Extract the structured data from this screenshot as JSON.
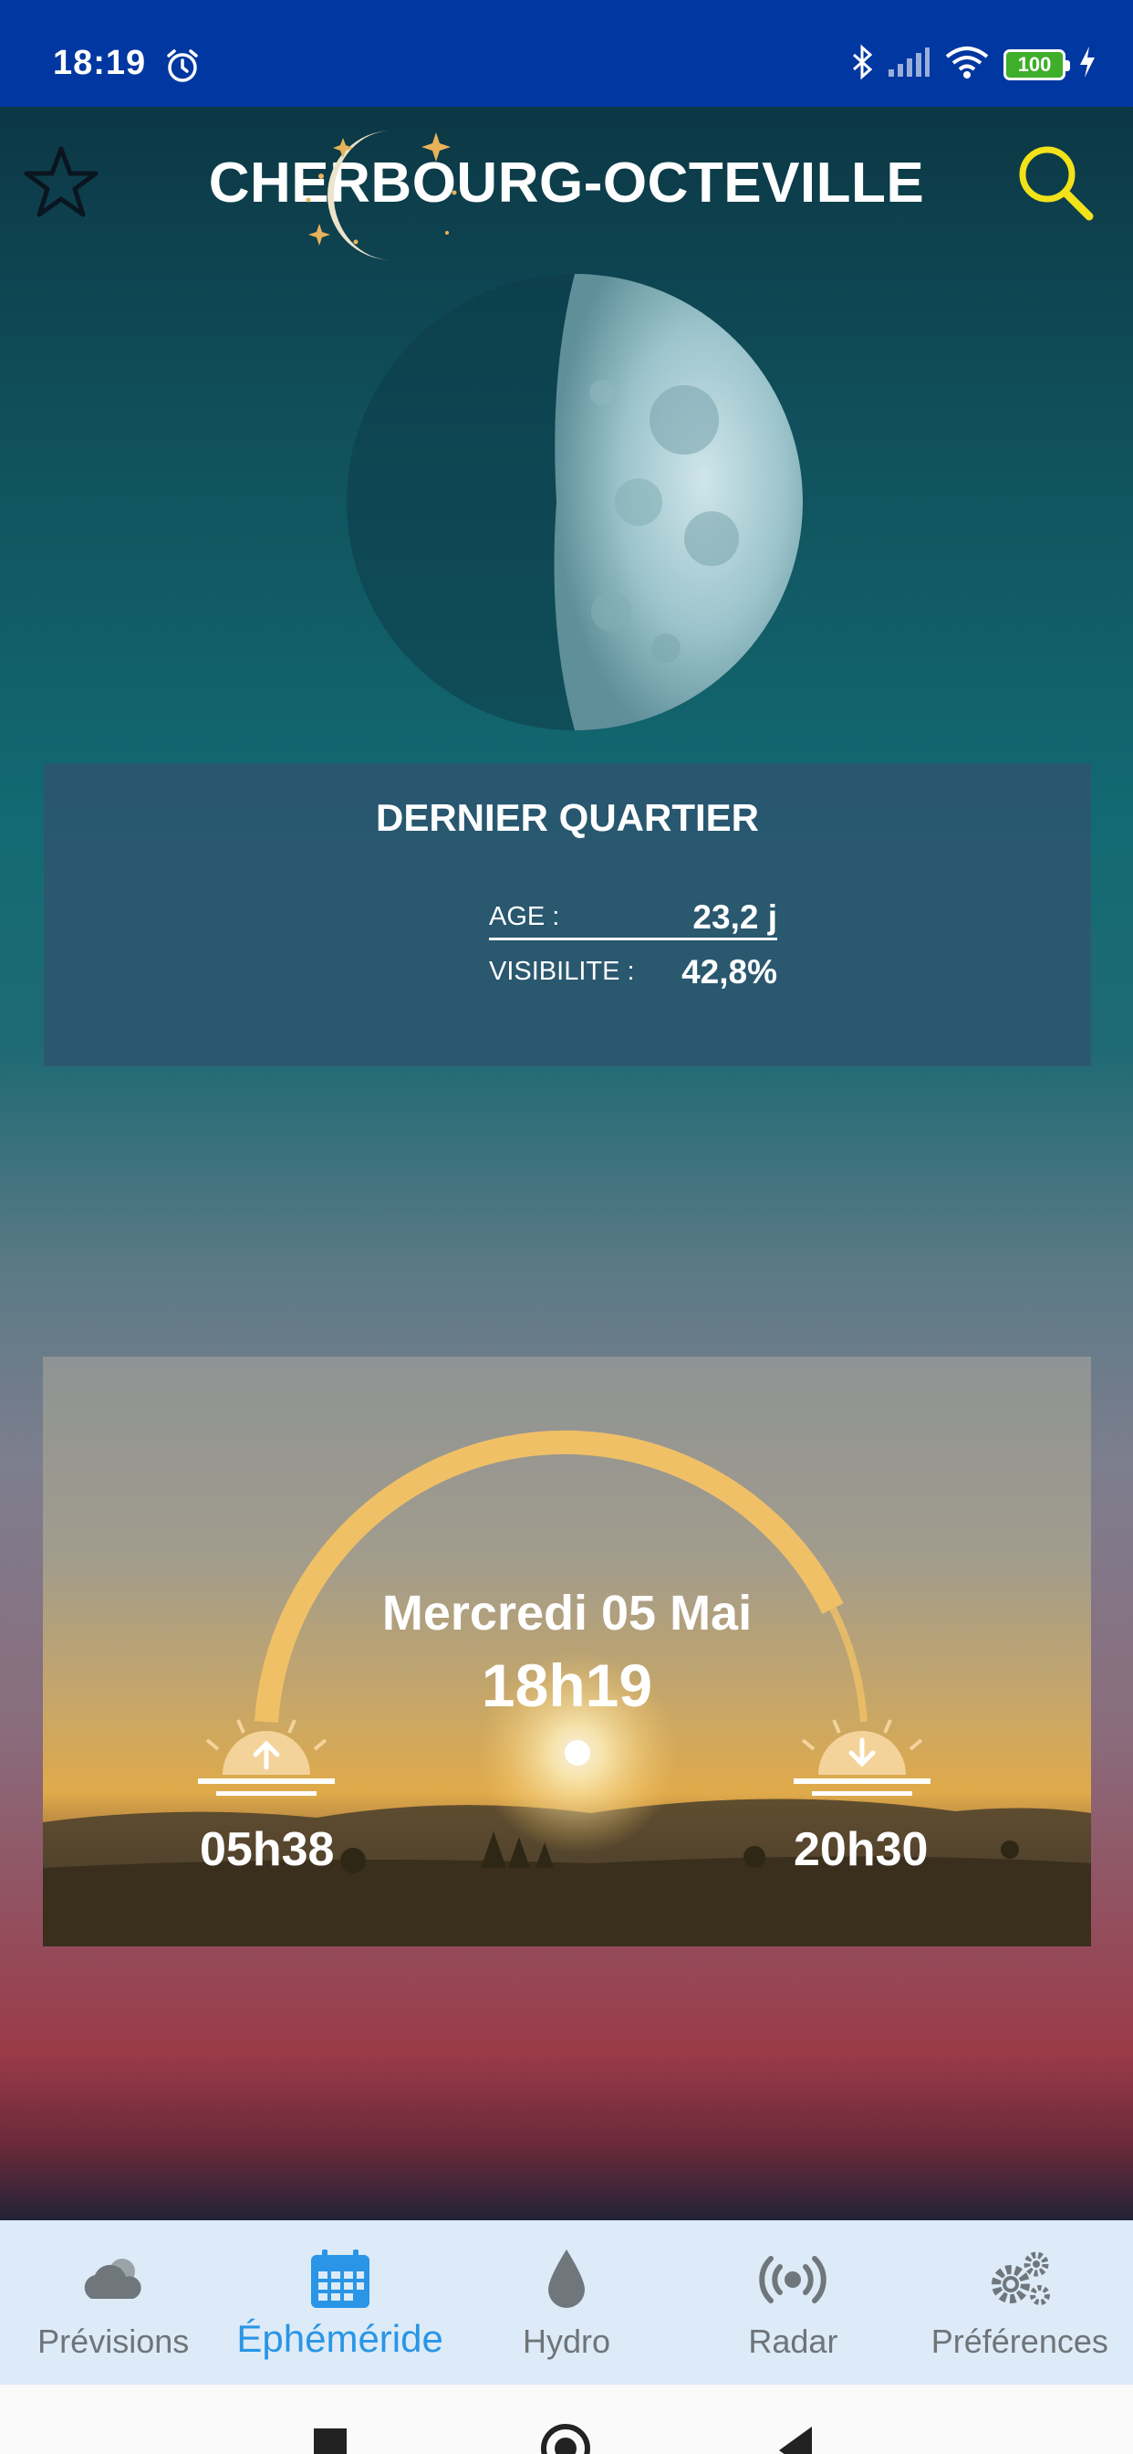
{
  "status_bar": {
    "time": "18:19",
    "battery": "100"
  },
  "header": {
    "city": "CHERBOURG-OCTEVILLE"
  },
  "moon_phase": {
    "name": "DERNIER QUARTIER",
    "age_label": "AGE :",
    "age_value": "23,2 j",
    "visibility_label": "VISIBILITE :",
    "visibility_value": "42,8%"
  },
  "sun": {
    "date": "Mercredi 05 Mai",
    "time": "18h19",
    "sunrise": "05h38",
    "sunset": "20h30"
  },
  "nav": {
    "items": [
      {
        "label": "Prévisions",
        "icon": "cloud-icon"
      },
      {
        "label": "Éphéméride",
        "icon": "calendar-icon"
      },
      {
        "label": "Hydro",
        "icon": "drop-icon"
      },
      {
        "label": "Radar",
        "icon": "radar-icon"
      },
      {
        "label": "Préférences",
        "icon": "gears-icon"
      }
    ],
    "active_index": 1
  },
  "colors": {
    "accent": "#2a95e6",
    "status_bar": "#0037a0",
    "search": "#f2e21a",
    "sun_arc": "#f0c067"
  }
}
